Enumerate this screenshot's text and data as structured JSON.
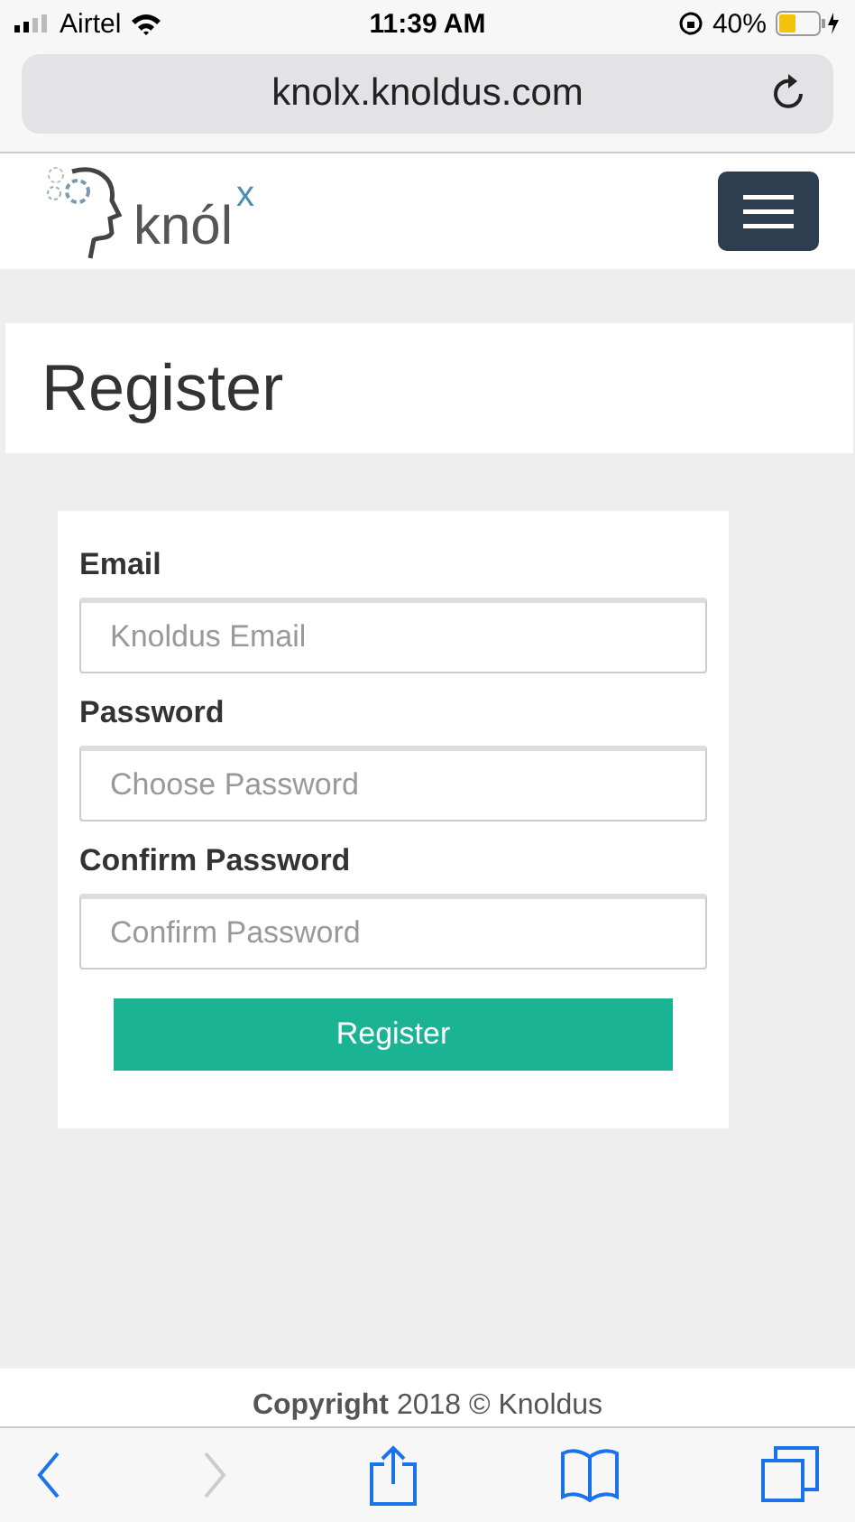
{
  "status_bar": {
    "carrier": "Airtel",
    "time": "11:39 AM",
    "battery": "40%"
  },
  "address_bar": {
    "url": "knolx.knoldus.com"
  },
  "header": {
    "logo_text": "knól",
    "logo_superscript": "x"
  },
  "page_title": "Register",
  "form": {
    "fields": [
      {
        "label": "Email",
        "placeholder": "Knoldus Email"
      },
      {
        "label": "Password",
        "placeholder": "Choose Password"
      },
      {
        "label": "Confirm Password",
        "placeholder": "Confirm Password"
      }
    ],
    "submit": "Register"
  },
  "footer": "**Copyright** 2018 © Knoldus",
  "toolbar": {
    "forward_disabled": true
  }
}
